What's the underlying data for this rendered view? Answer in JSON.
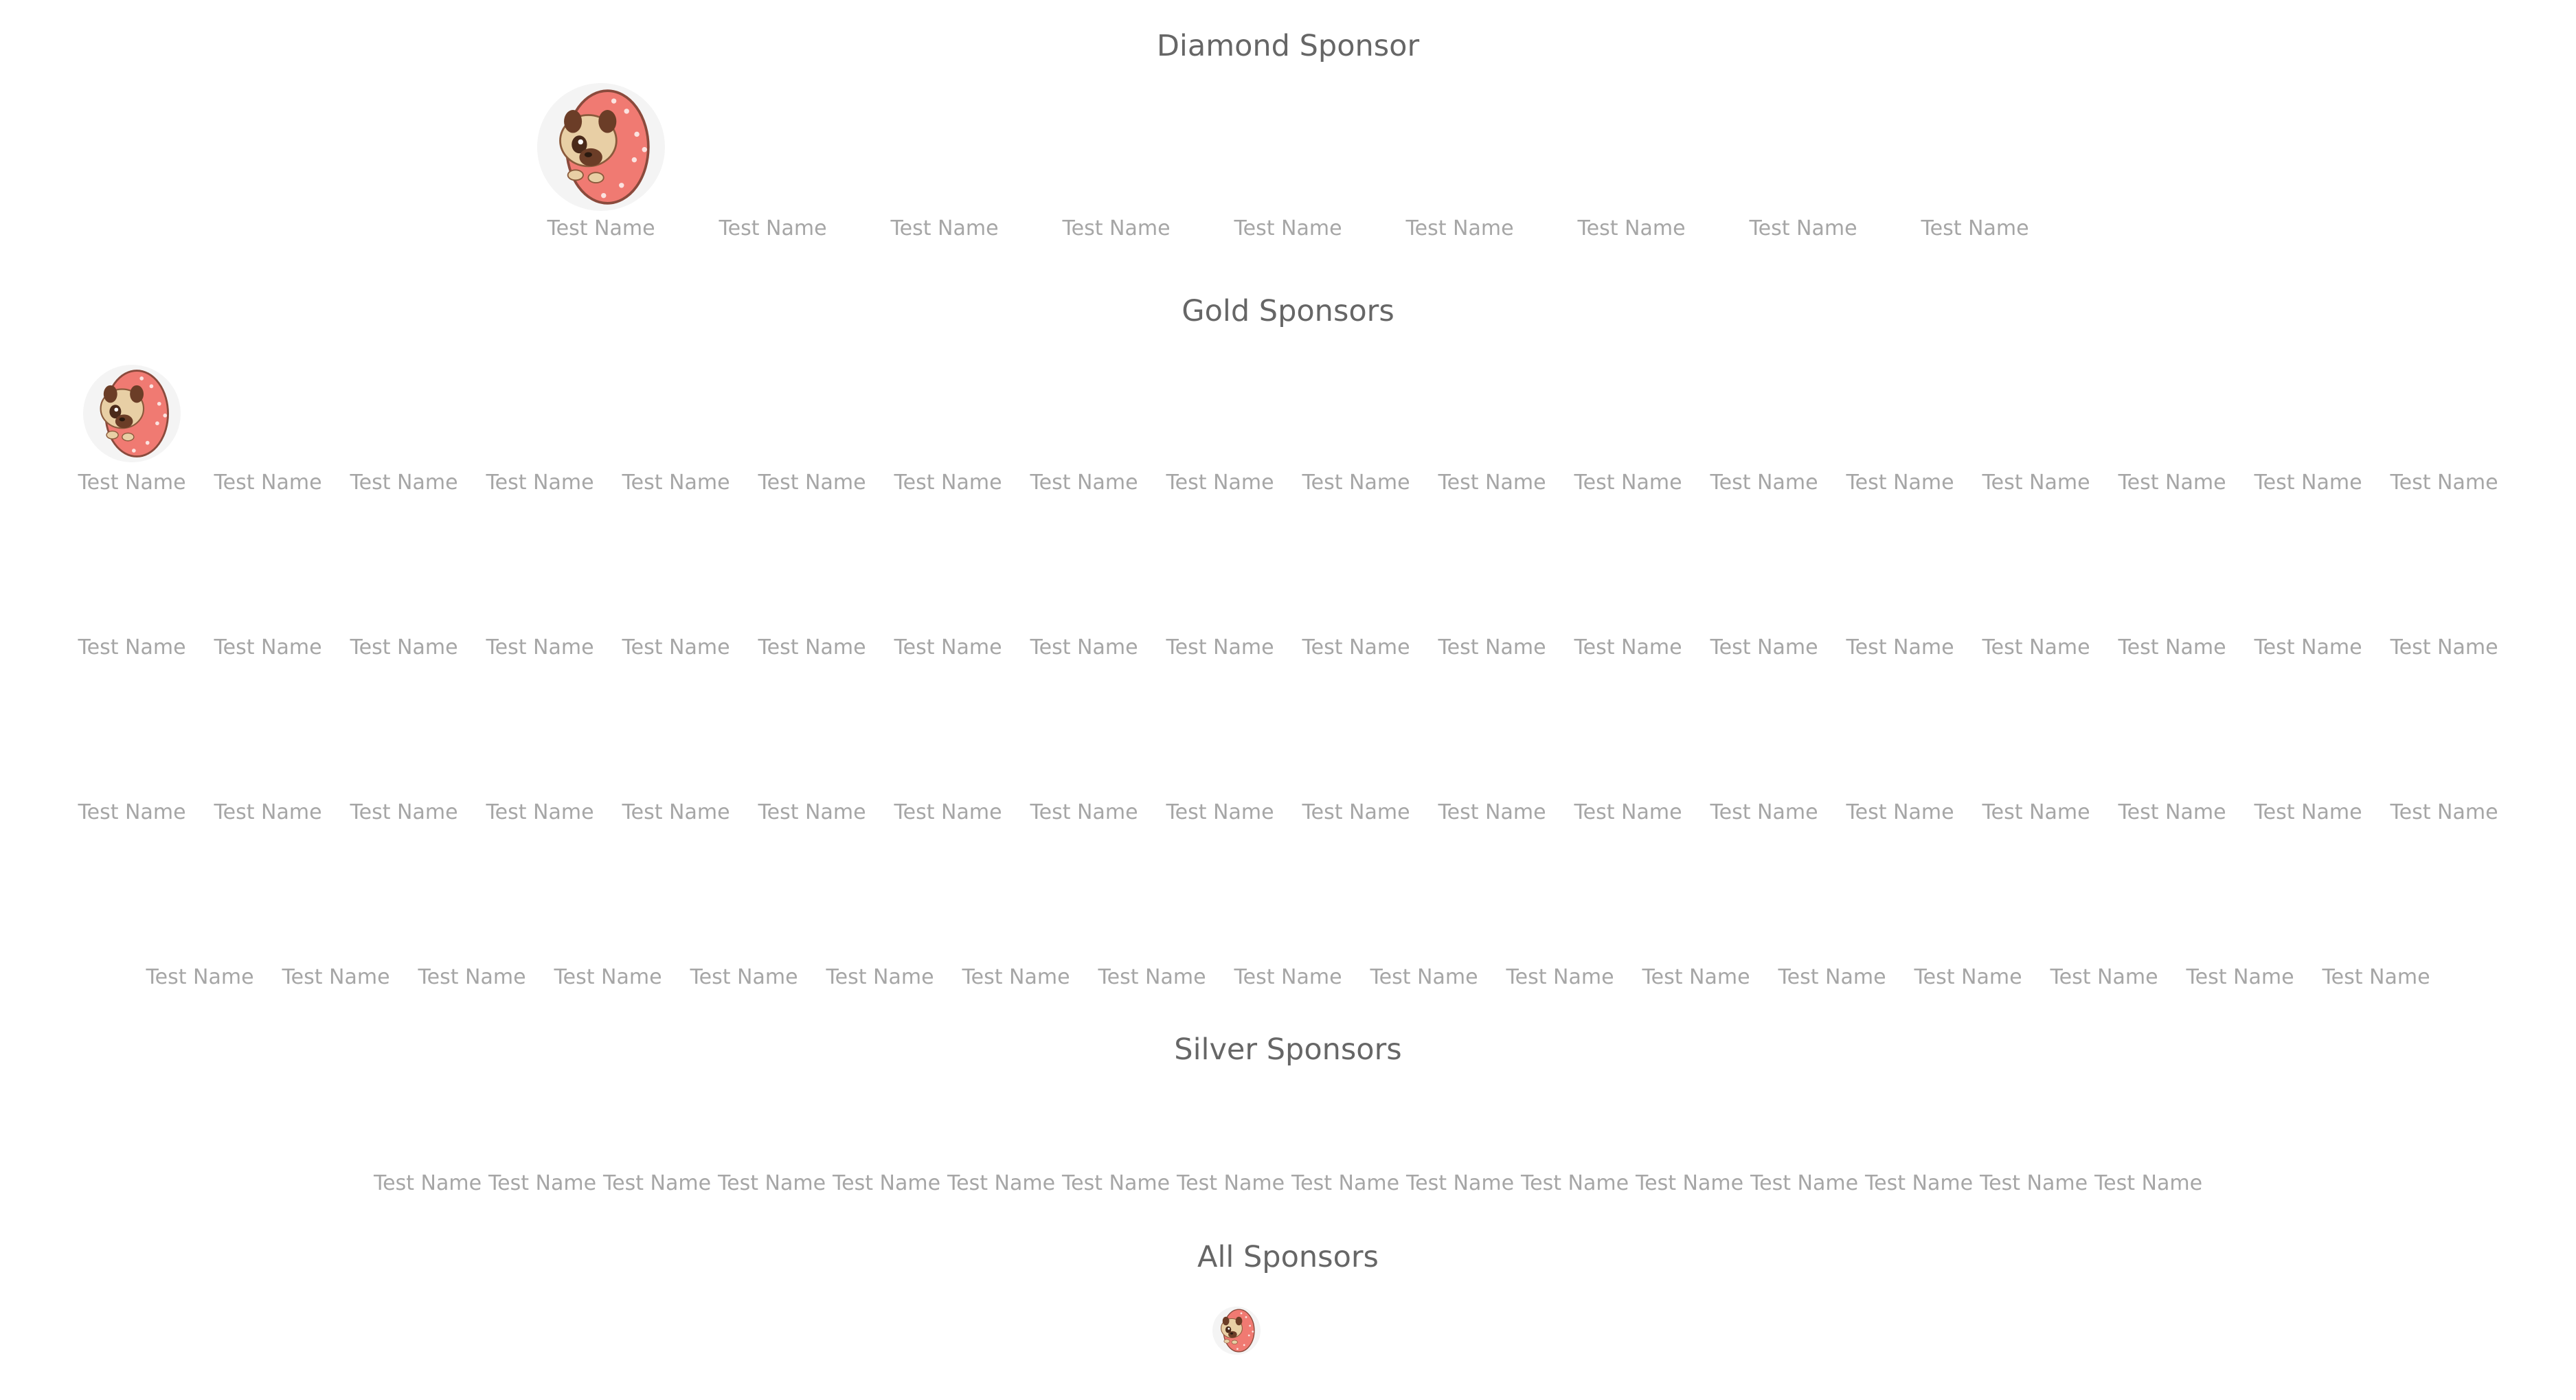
{
  "sections": {
    "diamond_title": "Diamond Sponsor",
    "gold_title": "Gold Sponsors",
    "silver_title": "Silver Sponsors",
    "all_title": "All Sponsors"
  },
  "diamond": {
    "names": [
      "Test Name",
      "Test Name",
      "Test Name",
      "Test Name",
      "Test Name",
      "Test Name",
      "Test Name",
      "Test Name",
      "Test Name"
    ]
  },
  "gold": {
    "rows": [
      [
        "Test Name",
        "Test Name",
        "Test Name",
        "Test Name",
        "Test Name",
        "Test Name",
        "Test Name",
        "Test Name",
        "Test Name",
        "Test Name",
        "Test Name",
        "Test Name",
        "Test Name",
        "Test Name",
        "Test Name",
        "Test Name",
        "Test Name",
        "Test Name"
      ],
      [
        "Test Name",
        "Test Name",
        "Test Name",
        "Test Name",
        "Test Name",
        "Test Name",
        "Test Name",
        "Test Name",
        "Test Name",
        "Test Name",
        "Test Name",
        "Test Name",
        "Test Name",
        "Test Name",
        "Test Name",
        "Test Name",
        "Test Name",
        "Test Name"
      ],
      [
        "Test Name",
        "Test Name",
        "Test Name",
        "Test Name",
        "Test Name",
        "Test Name",
        "Test Name",
        "Test Name",
        "Test Name",
        "Test Name",
        "Test Name",
        "Test Name",
        "Test Name",
        "Test Name",
        "Test Name",
        "Test Name",
        "Test Name",
        "Test Name"
      ],
      [
        "Test Name",
        "Test Name",
        "Test Name",
        "Test Name",
        "Test Name",
        "Test Name",
        "Test Name",
        "Test Name",
        "Test Name",
        "Test Name",
        "Test Name",
        "Test Name",
        "Test Name",
        "Test Name",
        "Test Name",
        "Test Name",
        "Test Name"
      ]
    ]
  },
  "silver": {
    "names": [
      "Test Name",
      "Test Name",
      "Test Name",
      "Test Name",
      "Test Name",
      "Test Name",
      "Test Name",
      "Test Name",
      "Test Name",
      "Test Name",
      "Test Name",
      "Test Name",
      "Test Name",
      "Test Name",
      "Test Name",
      "Test Name"
    ]
  },
  "icons": {
    "avatar": "pug-donut-icon"
  },
  "colors": {
    "title": "#666666",
    "name": "#a6a6a6",
    "donut": "#f07a72",
    "pug": "#e8cfa5"
  }
}
